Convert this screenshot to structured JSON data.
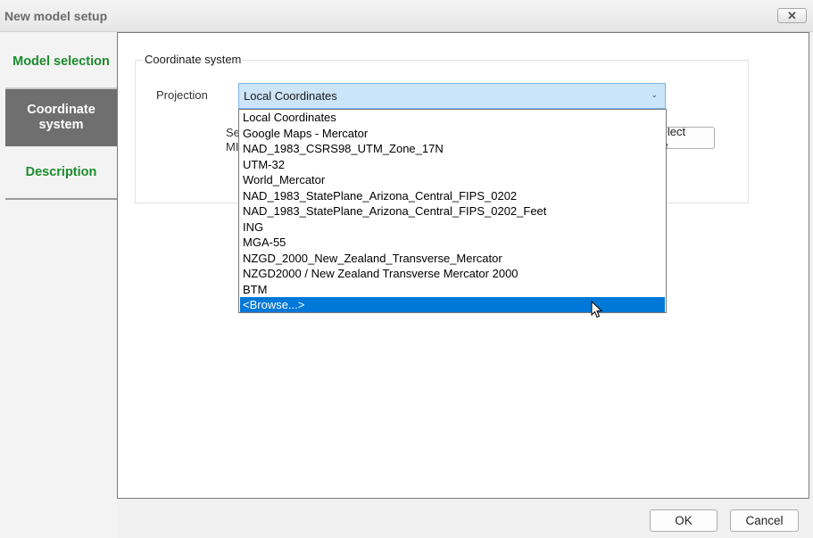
{
  "window": {
    "title": "New model setup",
    "close_icon": "close-icon"
  },
  "sidebar": {
    "tabs": [
      {
        "label": "Model selection",
        "active": false
      },
      {
        "label": "Coordinate system",
        "active": true
      },
      {
        "label": "Description",
        "active": false
      }
    ]
  },
  "main": {
    "group_title": "Coordinate system",
    "projection_label": "Projection",
    "projection_value": "Local Coordinates",
    "obscured_text_line1": "Se",
    "obscured_text_line2": "MI",
    "select_file_label": "Select file",
    "dropdown_options": [
      "Local Coordinates",
      "Google Maps - Mercator",
      "NAD_1983_CSRS98_UTM_Zone_17N",
      "UTM-32",
      "World_Mercator",
      "NAD_1983_StatePlane_Arizona_Central_FIPS_0202",
      "NAD_1983_StatePlane_Arizona_Central_FIPS_0202_Feet",
      "ING",
      "MGA-55",
      "NZGD_2000_New_Zealand_Transverse_Mercator",
      "NZGD2000 / New Zealand Transverse Mercator 2000",
      "BTM",
      "<Browse...>"
    ],
    "highlighted_option": "<Browse...>"
  },
  "footer": {
    "ok_label": "OK",
    "cancel_label": "Cancel"
  },
  "colors": {
    "tab_text_green": "#1b8c2c",
    "active_tab_bg": "#6f6f6f",
    "combo_bg": "#cce4f7",
    "selection_blue": "#0078d7"
  }
}
